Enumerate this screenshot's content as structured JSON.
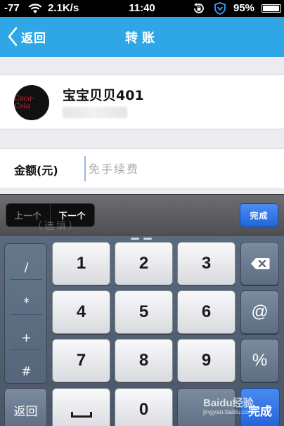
{
  "status_bar": {
    "signal": "-77",
    "speed": "2.1K/s",
    "time": "11:40",
    "battery": "95%",
    "battery_level": 0.95,
    "icons": [
      "wifi-icon",
      "rotation-lock-icon",
      "shield-icon",
      "battery-icon"
    ]
  },
  "nav": {
    "back_label": "返回",
    "title": "转账"
  },
  "recipient": {
    "name": "宝宝贝贝401",
    "avatar_text": "Coca-Cola"
  },
  "amount": {
    "label": "金额(元)",
    "placeholder": "免手续费",
    "value": ""
  },
  "toolbar": {
    "prev_label": "上一个",
    "next_label": "下一个",
    "done_label": "完成",
    "obscured_text": "（选填）"
  },
  "keyboard": {
    "symbols": [
      "/",
      "*",
      "+",
      "#"
    ],
    "digits": [
      "1",
      "2",
      "3",
      "4",
      "5",
      "6",
      "7",
      "8",
      "9",
      "0"
    ],
    "at": "@",
    "percent": "%",
    "return_label": "返回",
    "done_label": "完成"
  },
  "watermark": {
    "brand": "Baidu经验",
    "url": "jingyan.baidu.com"
  },
  "colors": {
    "nav_blue": "#2fa7e6",
    "done_blue": "#2166da"
  }
}
